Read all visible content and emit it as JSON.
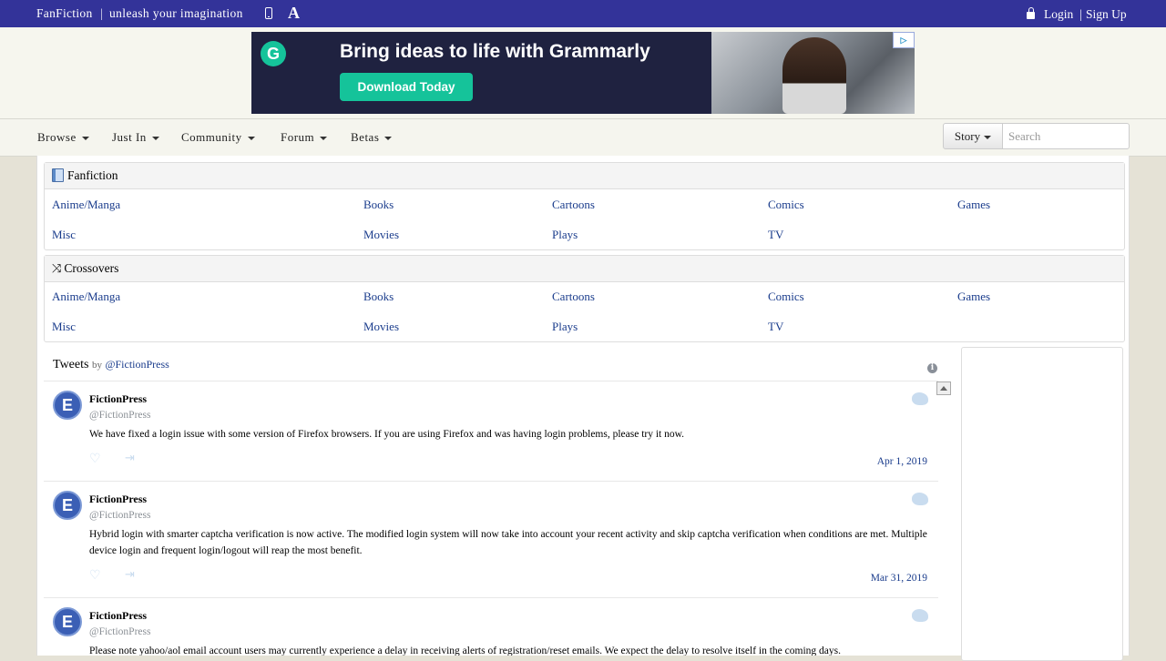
{
  "topbar": {
    "brand": "FanFiction",
    "separator": "|",
    "tagline": "unleash your imagination",
    "font_icon_glyph": "A",
    "login": "Login",
    "auth_separator": "|",
    "signup": "Sign Up"
  },
  "ad": {
    "logo_glyph": "G",
    "headline": "Bring ideas to life with Grammarly",
    "cta": "Download Today",
    "adchoices_glyph": "▷",
    "accent_color": "#15c39a"
  },
  "nav": {
    "items": [
      "Browse",
      "Just In",
      "Community",
      "Forum",
      "Betas"
    ],
    "search_type": "Story",
    "search_placeholder": "Search"
  },
  "fanfiction": {
    "title": "Fanfiction",
    "categories": [
      "Anime/Manga",
      "Books",
      "Cartoons",
      "Comics",
      "Games",
      "Misc",
      "Movies",
      "Plays",
      "TV"
    ]
  },
  "crossovers": {
    "title": "Crossovers",
    "categories": [
      "Anime/Manga",
      "Books",
      "Cartoons",
      "Comics",
      "Games",
      "Misc",
      "Movies",
      "Plays",
      "TV"
    ]
  },
  "tweets": {
    "title": "Tweets",
    "by": "by",
    "account": "@FictionPress",
    "items": [
      {
        "name": "FictionPress",
        "handle": "@FictionPress",
        "text": "We have fixed a login issue with some version of Firefox browsers. If you are using Firefox and was having login problems, please try it now.",
        "date": "Apr 1, 2019"
      },
      {
        "name": "FictionPress",
        "handle": "@FictionPress",
        "text": "Hybrid login with smarter captcha verification is now active. The modified login system will now take into account your recent activity and skip captcha verification when conditions are met. Multiple device login and frequent login/logout will reap the most benefit.",
        "date": "Mar 31, 2019"
      },
      {
        "name": "FictionPress",
        "handle": "@FictionPress",
        "text": "Please note yahoo/aol email account users may currently experience a delay in receiving alerts of registration/reset emails. We expect the delay to resolve itself in the coming days.",
        "date": ""
      }
    ]
  },
  "colors": {
    "topbar": "#333399",
    "link": "#1a3c8c"
  }
}
